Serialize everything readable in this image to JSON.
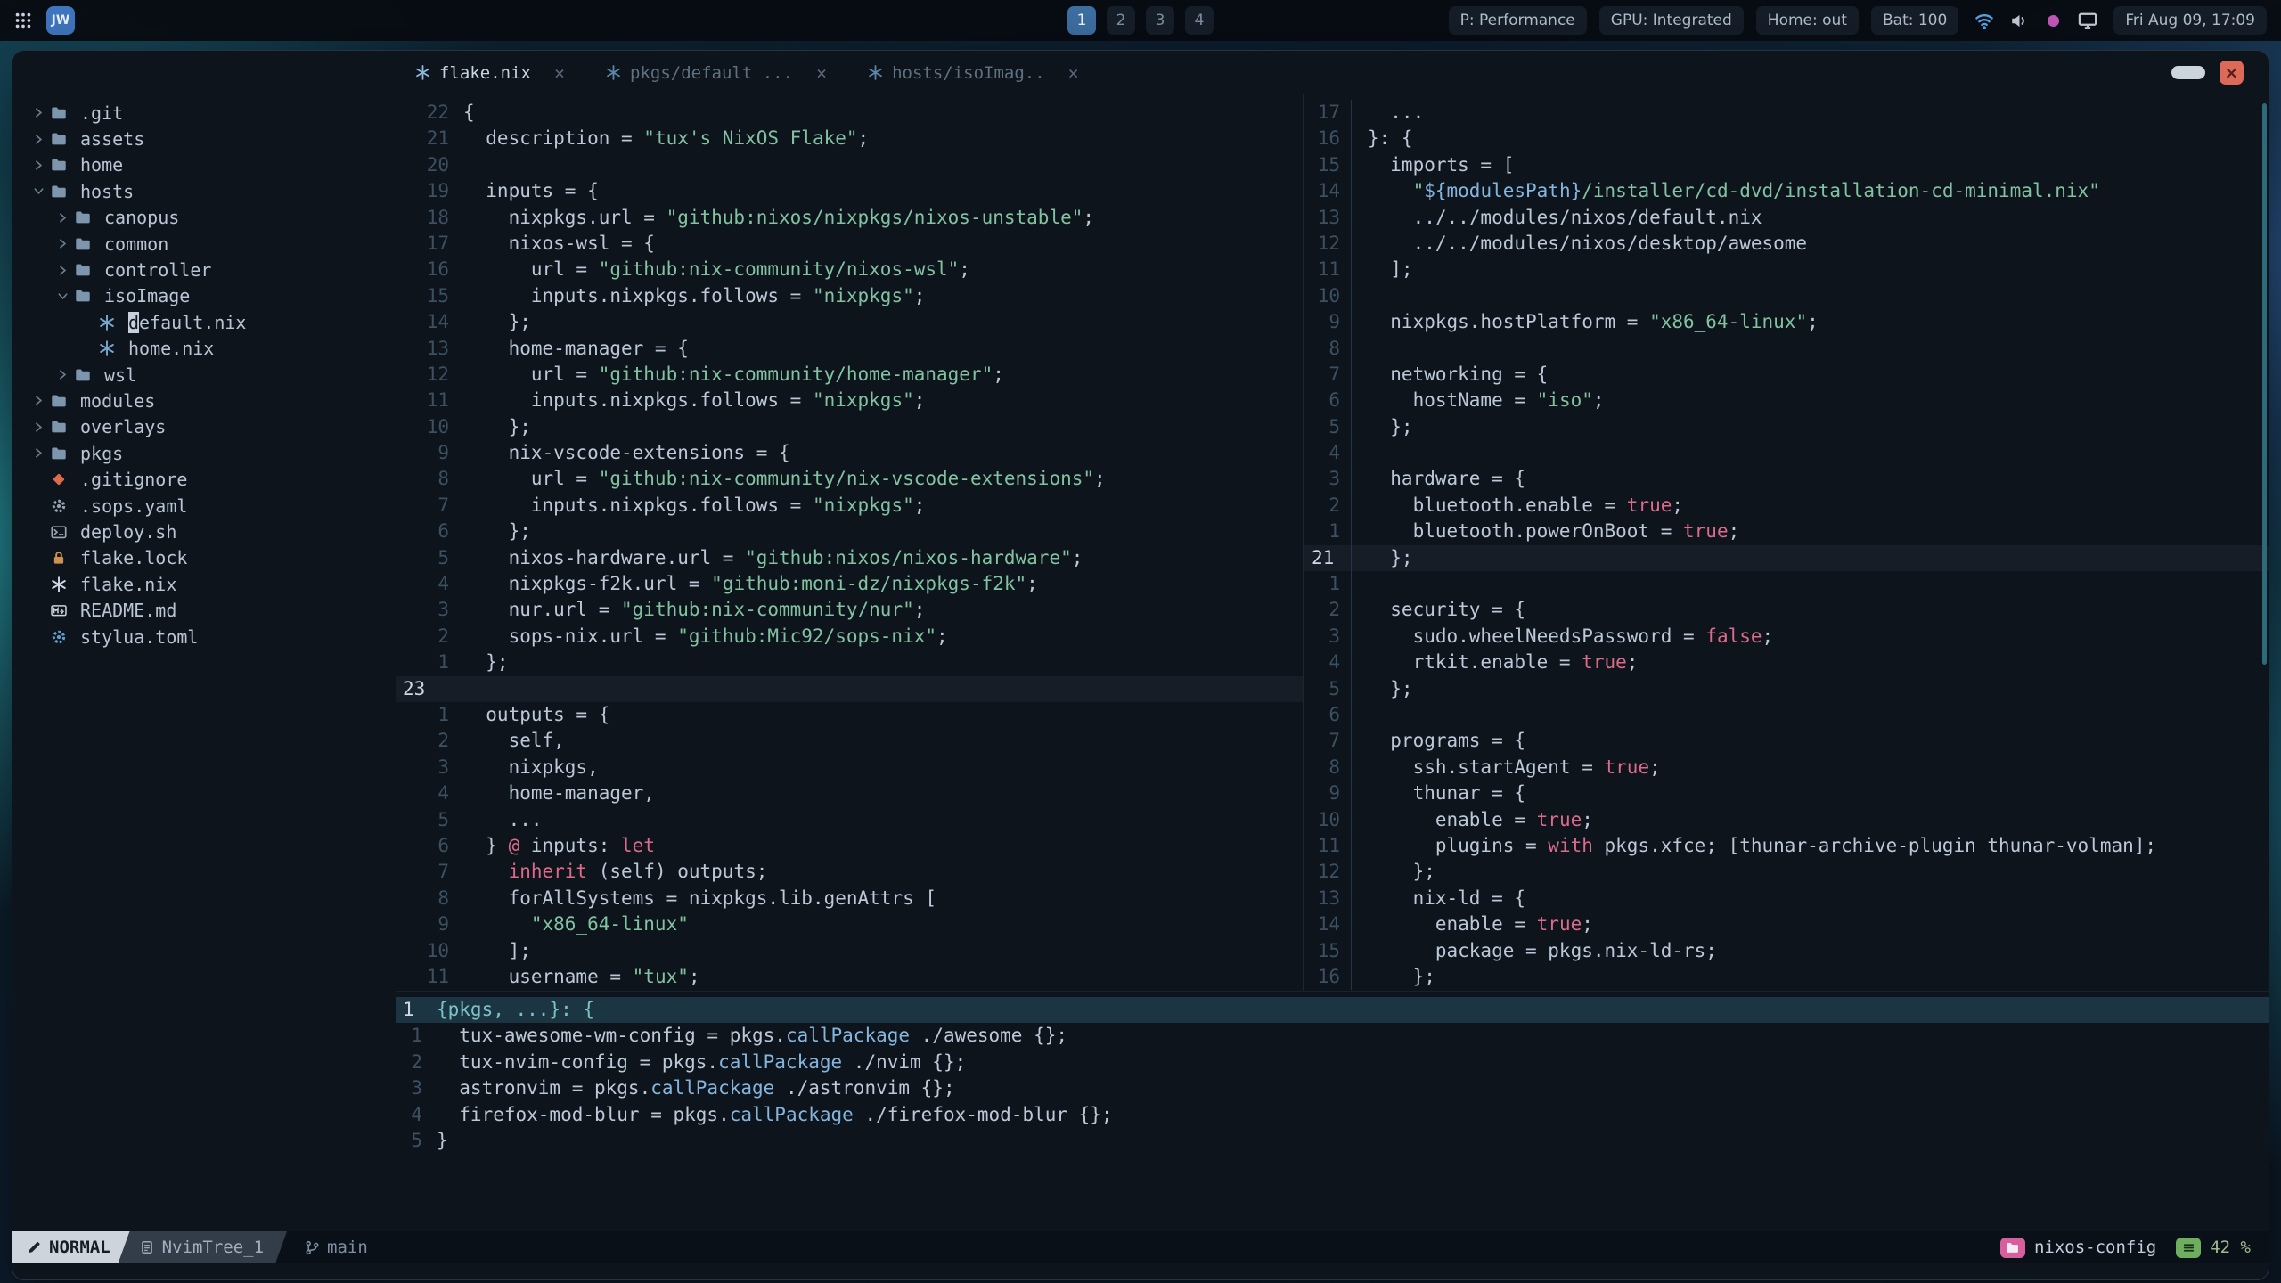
{
  "topbar": {
    "app_badge": "JW",
    "workspaces": [
      "1",
      "2",
      "3",
      "4"
    ],
    "active_workspace": "1",
    "status_items": [
      "P: Performance",
      "GPU: Integrated",
      "Home: out",
      "Bat: 100"
    ],
    "tray_icons": [
      "wifi-icon",
      "volume-icon",
      "recording-dot-icon",
      "display-icon"
    ],
    "clock": "Fri Aug 09, 17:09"
  },
  "window": {
    "controls": {
      "close": "×"
    },
    "tabs": [
      {
        "label": "flake.nix",
        "active": true
      },
      {
        "label": "pkgs/default ...",
        "active": false
      },
      {
        "label": "hosts/isoImag..",
        "active": false
      }
    ]
  },
  "tree": {
    "items": [
      {
        "label": ".git",
        "kind": "dir",
        "depth": 0
      },
      {
        "label": "assets",
        "kind": "dir",
        "depth": 0
      },
      {
        "label": "home",
        "kind": "dir",
        "depth": 0
      },
      {
        "label": "hosts",
        "kind": "dir-open",
        "depth": 0
      },
      {
        "label": "canopus",
        "kind": "dir",
        "depth": 1
      },
      {
        "label": "common",
        "kind": "dir",
        "depth": 1
      },
      {
        "label": "controller",
        "kind": "dir",
        "depth": 1
      },
      {
        "label": "isoImage",
        "kind": "dir-open",
        "depth": 1
      },
      {
        "label": "default.nix",
        "kind": "file",
        "icon": "nix",
        "depth": 2,
        "cursor": true
      },
      {
        "label": "home.nix",
        "kind": "file",
        "icon": "nix",
        "depth": 2
      },
      {
        "label": "wsl",
        "kind": "dir",
        "depth": 1
      },
      {
        "label": "modules",
        "kind": "dir",
        "depth": 0
      },
      {
        "label": "overlays",
        "kind": "dir",
        "depth": 0
      },
      {
        "label": "pkgs",
        "kind": "dir",
        "depth": 0
      },
      {
        "label": ".gitignore",
        "kind": "file",
        "icon": "git",
        "depth": 0
      },
      {
        "label": ".sops.yaml",
        "kind": "file",
        "icon": "gear-grey",
        "depth": 0
      },
      {
        "label": "deploy.sh",
        "kind": "file",
        "icon": "script",
        "depth": 0
      },
      {
        "label": "flake.lock",
        "kind": "file",
        "icon": "lock",
        "depth": 0
      },
      {
        "label": "flake.nix",
        "kind": "file",
        "icon": "nix-bright",
        "depth": 0
      },
      {
        "label": "README.md",
        "kind": "file",
        "icon": "markdown",
        "depth": 0
      },
      {
        "label": "stylua.toml",
        "kind": "file",
        "icon": "gear-blue",
        "depth": 0
      }
    ]
  },
  "panes": {
    "left": {
      "cursor": 22,
      "gutter": [
        "22",
        "21",
        "20",
        "19",
        "18",
        "17",
        "16",
        "15",
        "14",
        "13",
        "12",
        "11",
        "10",
        "9",
        "8",
        "7",
        "6",
        "5",
        "4",
        "3",
        "2",
        "1",
        "23",
        "1",
        "2",
        "3",
        "4",
        "5",
        "6",
        "7",
        "8",
        "9",
        "10",
        "11"
      ],
      "lines": [
        [
          [
            "t",
            "{"
          ]
        ],
        [
          [
            "t",
            "  description = "
          ],
          [
            "s",
            "\"tux's NixOS Flake\""
          ],
          [
            "t",
            ";"
          ]
        ],
        [],
        [
          [
            "t",
            "  inputs = {"
          ]
        ],
        [
          [
            "t",
            "    nixpkgs.url = "
          ],
          [
            "s",
            "\"github:nixos/nixpkgs/nixos-unstable\""
          ],
          [
            "t",
            ";"
          ]
        ],
        [
          [
            "t",
            "    nixos-wsl = {"
          ]
        ],
        [
          [
            "t",
            "      url = "
          ],
          [
            "s",
            "\"github:nix-community/nixos-wsl\""
          ],
          [
            "t",
            ";"
          ]
        ],
        [
          [
            "t",
            "      inputs.nixpkgs.follows = "
          ],
          [
            "s",
            "\"nixpkgs\""
          ],
          [
            "t",
            ";"
          ]
        ],
        [
          [
            "t",
            "    };"
          ]
        ],
        [
          [
            "t",
            "    home-manager = {"
          ]
        ],
        [
          [
            "t",
            "      url = "
          ],
          [
            "s",
            "\"github:nix-community/home-manager\""
          ],
          [
            "t",
            ";"
          ]
        ],
        [
          [
            "t",
            "      inputs.nixpkgs.follows = "
          ],
          [
            "s",
            "\"nixpkgs\""
          ],
          [
            "t",
            ";"
          ]
        ],
        [
          [
            "t",
            "    };"
          ]
        ],
        [
          [
            "t",
            "    nix-vscode-extensions = {"
          ]
        ],
        [
          [
            "t",
            "      url = "
          ],
          [
            "s",
            "\"github:nix-community/nix-vscode-extensions\""
          ],
          [
            "t",
            ";"
          ]
        ],
        [
          [
            "t",
            "      inputs.nixpkgs.follows = "
          ],
          [
            "s",
            "\"nixpkgs\""
          ],
          [
            "t",
            ";"
          ]
        ],
        [
          [
            "t",
            "    };"
          ]
        ],
        [
          [
            "t",
            "    nixos-hardware.url = "
          ],
          [
            "s",
            "\"github:nixos/nixos-hardware\""
          ],
          [
            "t",
            ";"
          ]
        ],
        [
          [
            "t",
            "    nixpkgs-f2k.url = "
          ],
          [
            "s",
            "\"github:moni-dz/nixpkgs-f2k\""
          ],
          [
            "t",
            ";"
          ]
        ],
        [
          [
            "t",
            "    nur.url = "
          ],
          [
            "s",
            "\"github:nix-community/nur\""
          ],
          [
            "t",
            ";"
          ]
        ],
        [
          [
            "t",
            "    sops-nix.url = "
          ],
          [
            "s",
            "\"github:Mic92/sops-nix\""
          ],
          [
            "t",
            ";"
          ]
        ],
        [
          [
            "t",
            "  };"
          ]
        ],
        [],
        [
          [
            "t",
            "  outputs = {"
          ]
        ],
        [
          [
            "t",
            "    self,"
          ]
        ],
        [
          [
            "t",
            "    nixpkgs,"
          ]
        ],
        [
          [
            "t",
            "    home-manager,"
          ]
        ],
        [
          [
            "t",
            "    ..."
          ]
        ],
        [
          [
            "t",
            "  } "
          ],
          [
            "k",
            "@"
          ],
          [
            "t",
            " inputs: "
          ],
          [
            "k",
            "let"
          ]
        ],
        [
          [
            "t",
            "    "
          ],
          [
            "k",
            "inherit"
          ],
          [
            "t",
            " (self) outputs;"
          ]
        ],
        [
          [
            "t",
            "    forAllSystems = nixpkgs.lib.genAttrs ["
          ]
        ],
        [
          [
            "t",
            "      "
          ],
          [
            "s",
            "\"x86_64-linux\""
          ]
        ],
        [
          [
            "t",
            "    ];"
          ]
        ],
        [
          [
            "t",
            "    username = "
          ],
          [
            "s",
            "\"tux\""
          ],
          [
            "t",
            ";"
          ]
        ]
      ]
    },
    "right": {
      "cursor": 17,
      "gutter_sep": true,
      "gutter": [
        "17",
        "16",
        "15",
        "14",
        "13",
        "12",
        "11",
        "10",
        "9",
        "8",
        "7",
        "6",
        "5",
        "4",
        "3",
        "2",
        "1",
        "21",
        "1",
        "2",
        "3",
        "4",
        "5",
        "6",
        "7",
        "8",
        "9",
        "10",
        "11",
        "12",
        "13",
        "14",
        "15",
        "16"
      ],
      "lines": [
        [
          [
            "t",
            "  ..."
          ]
        ],
        [
          [
            "t",
            "}: {"
          ]
        ],
        [
          [
            "t",
            "  imports = ["
          ]
        ],
        [
          [
            "t",
            "    "
          ],
          [
            "s",
            "\""
          ],
          [
            "b",
            "${modulesPath}"
          ],
          [
            "s",
            "/installer/cd-dvd/installation-cd-minimal.nix\""
          ]
        ],
        [
          [
            "t",
            "    ../../modules/nixos/default.nix"
          ]
        ],
        [
          [
            "t",
            "    ../../modules/nixos/desktop/awesome"
          ]
        ],
        [
          [
            "t",
            "  ];"
          ]
        ],
        [],
        [
          [
            "t",
            "  nixpkgs.hostPlatform = "
          ],
          [
            "s",
            "\"x86_64-linux\""
          ],
          [
            "t",
            ";"
          ]
        ],
        [],
        [
          [
            "t",
            "  networking = {"
          ]
        ],
        [
          [
            "t",
            "    hostName = "
          ],
          [
            "s",
            "\"iso\""
          ],
          [
            "t",
            ";"
          ]
        ],
        [
          [
            "t",
            "  };"
          ]
        ],
        [],
        [
          [
            "t",
            "  hardware = {"
          ]
        ],
        [
          [
            "t",
            "    bluetooth.enable = "
          ],
          [
            "k",
            "true"
          ],
          [
            "t",
            ";"
          ]
        ],
        [
          [
            "t",
            "    bluetooth.powerOnBoot = "
          ],
          [
            "k",
            "true"
          ],
          [
            "t",
            ";"
          ]
        ],
        [
          [
            "t",
            "  };"
          ]
        ],
        [],
        [
          [
            "t",
            "  security = {"
          ]
        ],
        [
          [
            "t",
            "    sudo.wheelNeedsPassword = "
          ],
          [
            "k",
            "false"
          ],
          [
            "t",
            ";"
          ]
        ],
        [
          [
            "t",
            "    rtkit.enable = "
          ],
          [
            "k",
            "true"
          ],
          [
            "t",
            ";"
          ]
        ],
        [
          [
            "t",
            "  };"
          ]
        ],
        [],
        [
          [
            "t",
            "  programs = {"
          ]
        ],
        [
          [
            "t",
            "    ssh.startAgent = "
          ],
          [
            "k",
            "true"
          ],
          [
            "t",
            ";"
          ]
        ],
        [
          [
            "t",
            "    thunar = {"
          ]
        ],
        [
          [
            "t",
            "      enable = "
          ],
          [
            "k",
            "true"
          ],
          [
            "t",
            ";"
          ]
        ],
        [
          [
            "t",
            "      plugins = "
          ],
          [
            "k",
            "with"
          ],
          [
            "t",
            " pkgs.xfce; [thunar-archive-plugin thunar-volman];"
          ]
        ],
        [
          [
            "t",
            "    };"
          ]
        ],
        [
          [
            "t",
            "    nix-ld = {"
          ]
        ],
        [
          [
            "t",
            "      enable = "
          ],
          [
            "k",
            "true"
          ],
          [
            "t",
            ";"
          ]
        ],
        [
          [
            "t",
            "      package = pkgs.nix-ld-rs;"
          ]
        ],
        [
          [
            "t",
            "    };"
          ]
        ]
      ]
    },
    "bottom": {
      "cursor": 0,
      "gutter": [
        "1",
        "1",
        "2",
        "3",
        "4",
        "5"
      ],
      "lines": [
        [
          [
            "h",
            "{pkgs, ...}: {"
          ]
        ],
        [
          [
            "t",
            "  tux-awesome-wm-config = pkgs."
          ],
          [
            "b",
            "callPackage"
          ],
          [
            "t",
            " ./awesome {};"
          ]
        ],
        [
          [
            "t",
            "  tux-nvim-config = pkgs."
          ],
          [
            "b",
            "callPackage"
          ],
          [
            "t",
            " ./nvim {};"
          ]
        ],
        [
          [
            "t",
            "  astronvim = pkgs."
          ],
          [
            "b",
            "callPackage"
          ],
          [
            "t",
            " ./astronvim {};"
          ]
        ],
        [
          [
            "t",
            "  firefox-mod-blur = pkgs."
          ],
          [
            "b",
            "callPackage"
          ],
          [
            "t",
            " ./firefox-mod-blur {};"
          ]
        ],
        [
          [
            "t",
            "}"
          ]
        ]
      ]
    }
  },
  "statusline": {
    "mode": "NORMAL",
    "buffer": "NvimTree_1",
    "branch": "main",
    "project": "nixos-config",
    "progress": "42 %"
  },
  "colors": {
    "accent_blue": "#3d6fa3",
    "string_green": "#82c2a0",
    "keyword_pink": "#de6a8a",
    "func_blue": "#85b5dd",
    "chip_pink": "#d85f9e",
    "chip_green": "#6fae5f"
  }
}
